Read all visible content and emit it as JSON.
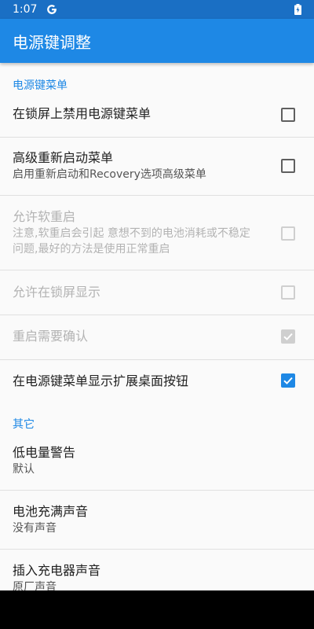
{
  "status": {
    "time": "1:07"
  },
  "app_bar": {
    "title": "电源键调整"
  },
  "sections": {
    "power_menu": {
      "header": "电源键菜单"
    },
    "other": {
      "header": "其它"
    }
  },
  "prefs": {
    "disable_on_lockscreen": {
      "title": "在锁屏上禁用电源键菜单",
      "checked": false,
      "enabled": true
    },
    "advanced_reboot": {
      "title": "高级重新启动菜单",
      "summary": "启用重新启动和Recovery选项高级菜单",
      "checked": false,
      "enabled": true
    },
    "soft_reboot": {
      "title": "允许软重启",
      "summary": "注意,软重启会引起 意想不到的电池消耗或不稳定问题,最好的方法是使用正常重启",
      "checked": false,
      "enabled": false
    },
    "allow_on_lockscreen": {
      "title": "允许在锁屏显示",
      "checked": false,
      "enabled": false
    },
    "confirm_reboot": {
      "title": "重启需要确认",
      "checked": true,
      "enabled": false
    },
    "expanded_desktop": {
      "title": "在电源键菜单显示扩展桌面按钮",
      "checked": true,
      "enabled": true
    },
    "low_battery_warning": {
      "title": "低电量警告",
      "summary": "默认"
    },
    "battery_full_sound": {
      "title": "电池充满声音",
      "summary": "没有声音"
    },
    "charger_sound": {
      "title": "插入充电器声音",
      "summary": "原厂声音"
    }
  },
  "colors": {
    "accent": "#1e88e5",
    "status_bar": "#1a6fc4",
    "disabled": "#b3b3b3"
  },
  "icons": {
    "status": [
      "google-g-icon",
      "battery-charging-icon"
    ],
    "checkbox": "check-icon"
  }
}
